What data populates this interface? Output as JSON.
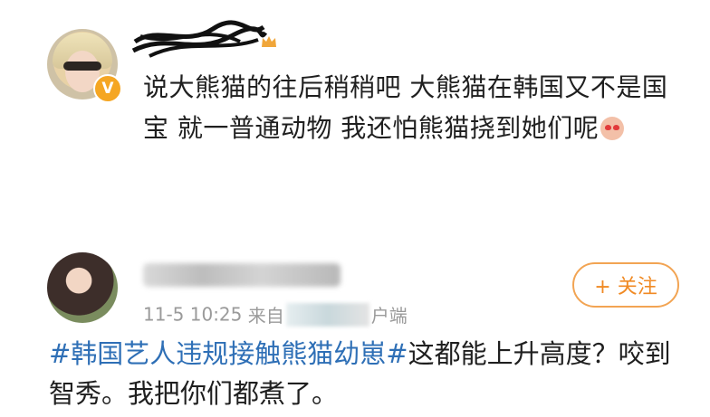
{
  "comment": {
    "avatar_icon": "user-avatar-icon",
    "badge": "V",
    "crown_icon": "crown-icon",
    "text": "说大熊猫的往后稍稍吧 大熊猫在韩国又不是国宝 就一普通动物 我还怕熊猫挠到她们呢",
    "emoji_icon": "heart-eyes-emoji-icon"
  },
  "post": {
    "avatar_icon": "user-avatar-icon",
    "follow_label": "+ 关注",
    "date": "11-5 10:25",
    "source_prefix": "来自",
    "source_suffix": "户端",
    "hashtag": "#韩国艺人违规接触熊猫幼崽#",
    "text": "这都能上升高度？咬到智秀。我把你们都煮了。"
  },
  "colors": {
    "hashtag": "#2e6fb6",
    "follow": "#f08a24",
    "meta": "#9a9a9a",
    "badge": "#f5a623"
  }
}
